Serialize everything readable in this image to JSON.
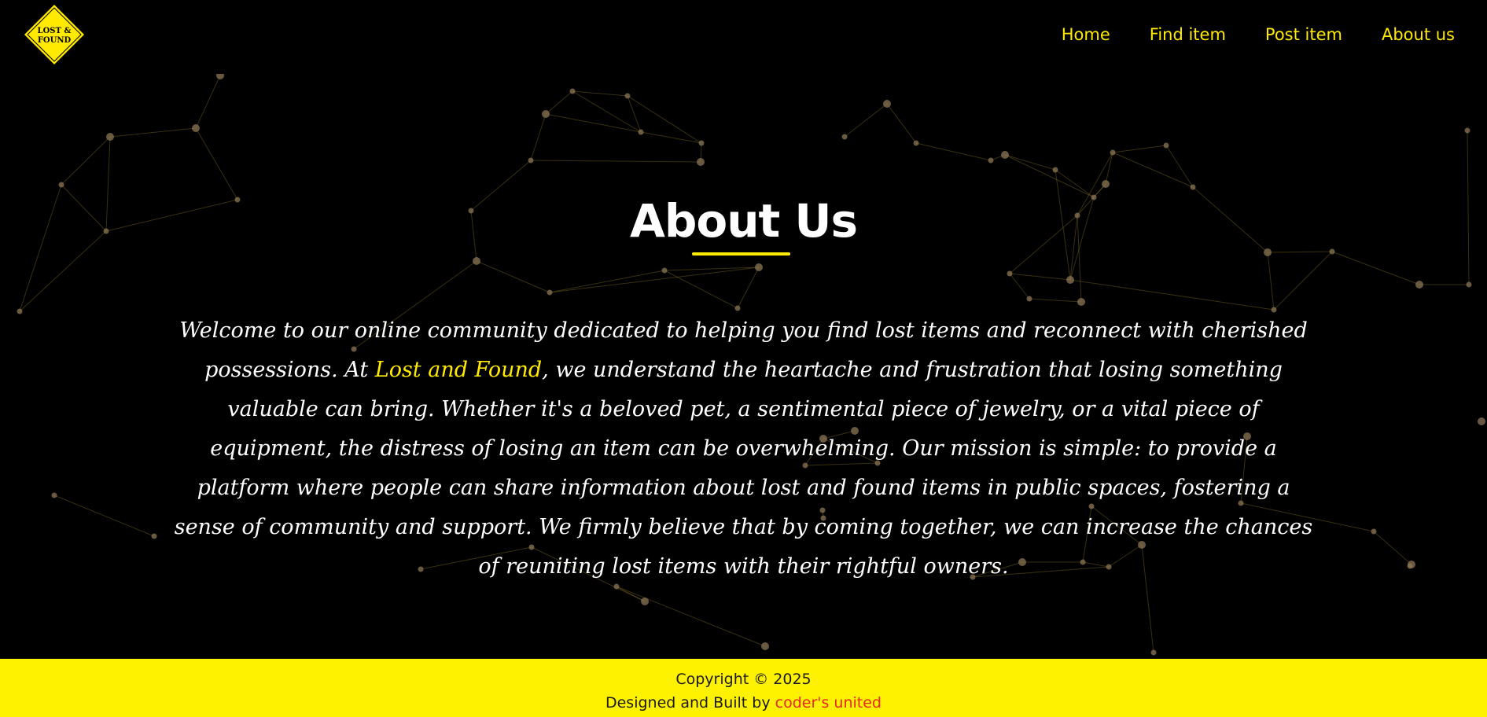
{
  "logo": {
    "line1": "LOST &",
    "line2": "FOUND",
    "color": "#ffea00"
  },
  "nav": {
    "items": [
      {
        "label": "Home"
      },
      {
        "label": "Find item"
      },
      {
        "label": "Post item"
      },
      {
        "label": "About us"
      }
    ]
  },
  "main": {
    "title": "About Us",
    "paragraph_before": "Welcome to our online community dedicated to helping you find lost items and reconnect with cherished possessions. At ",
    "paragraph_highlight": "Lost and Found",
    "paragraph_after": ", we understand the heartache and frustration that losing something valuable can bring. Whether it's a beloved pet, a sentimental piece of jewelry, or a vital piece of equipment, the distress of losing an item can be overwhelming. Our mission is simple: to provide a platform where people can share information about lost and found items in public spaces, fostering a sense of community and support. We firmly believe that by coming together, we can increase the chances of reuniting lost items with their rightful owners."
  },
  "footer": {
    "copyright": "Copyright © 2025",
    "built_by_prefix": "Designed and Built by ",
    "built_by_link": "coder's united"
  },
  "colors": {
    "accent": "#ffea00",
    "background": "#000000",
    "footer_bg": "#fff200",
    "link_red": "#e8261c",
    "network_line": "#a08a2c",
    "network_node": "#8b7655"
  }
}
